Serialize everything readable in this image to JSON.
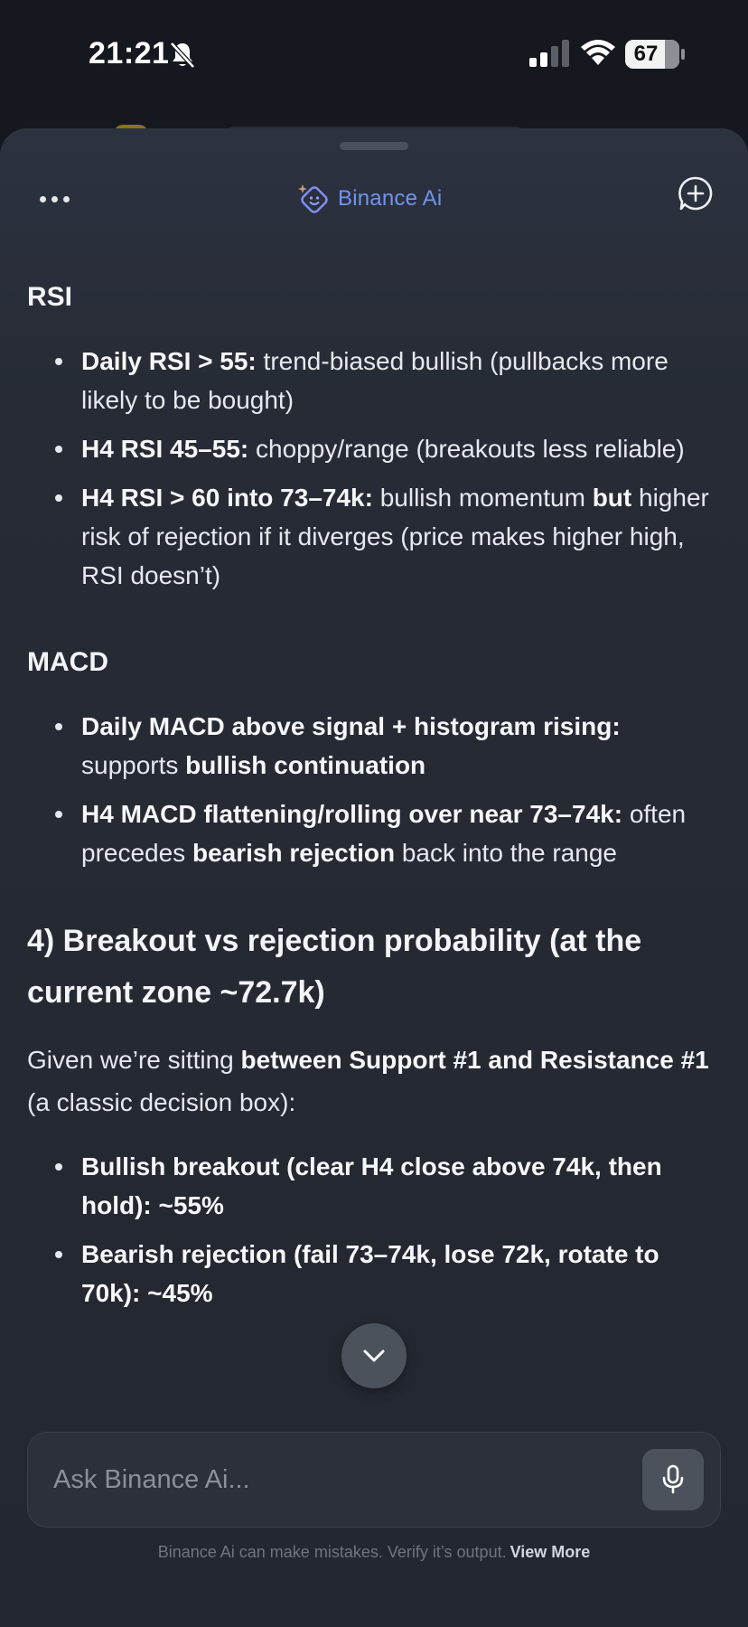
{
  "status_bar": {
    "time": "21:21",
    "battery": "67",
    "icons": [
      "bell-slash-icon",
      "signal-icon",
      "wifi-icon",
      "battery-icon"
    ]
  },
  "header": {
    "brand": "Binance Ai",
    "brand_color": "#6f95f0",
    "icons": [
      "more-dots-icon",
      "binance-ai-logo-icon",
      "new-chat-icon"
    ]
  },
  "rsi": {
    "heading": "RSI",
    "items": [
      {
        "b1": "Daily RSI > 55:",
        "t1": " trend-biased bullish (pullbacks more likely to be bought)"
      },
      {
        "b1": "H4 RSI 45–55:",
        "t1": " choppy/range (breakouts less reliable)"
      },
      {
        "b1": "H4 RSI > 60 into 73–74k:",
        "t1": " bullish momentum ",
        "b2": "but",
        "t2": " higher risk of rejection if it diverges (price makes higher high, RSI doesn’t)"
      }
    ]
  },
  "macd": {
    "heading": "MACD",
    "items": [
      {
        "b1": "Daily MACD above signal + histogram rising:",
        "t1": " supports ",
        "b2": "bullish continuation"
      },
      {
        "b1": "H4 MACD flattening/rolling over near 73–74k:",
        "t1": " often precedes ",
        "b2": "bearish rejection",
        "t2": " back into the range"
      }
    ]
  },
  "section4": {
    "heading": "4) Breakout vs rejection probability (at the current zone ~72.7k)",
    "intro_t1": "Given we’re sitting ",
    "intro_b1": "between Support #1 and Resistance #1",
    "intro_t2": " (a classic decision box):",
    "items": [
      {
        "b1": "Bullish breakout (clear H4 close above 74k, then hold): ~55%"
      },
      {
        "b1": "Bearish rejection (fail 73–74k, lose 72k, rotate to 70k): ~45%"
      }
    ]
  },
  "composer": {
    "placeholder": "Ask Binance Ai...",
    "icons": [
      "microphone-icon",
      "chevron-down-icon"
    ]
  },
  "footer": {
    "disclaimer": "Binance Ai can make mistakes. Verify it’s output.",
    "view_more": "View More"
  }
}
